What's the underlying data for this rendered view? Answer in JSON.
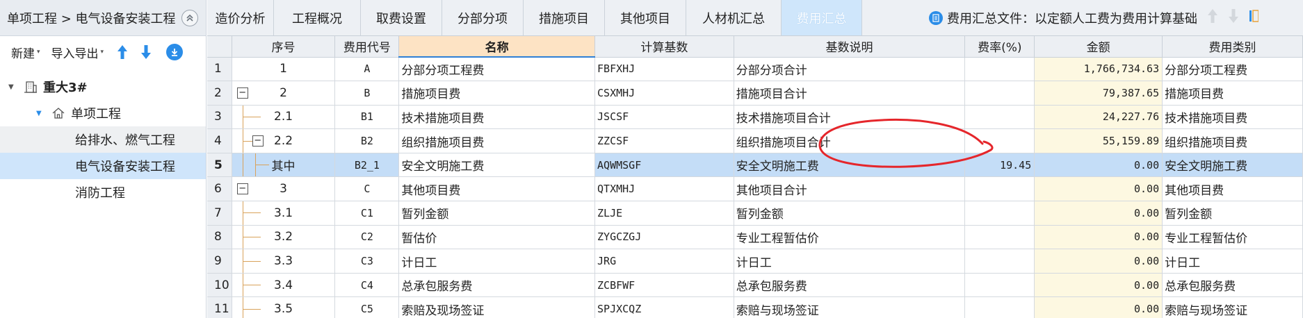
{
  "breadcrumb": {
    "text": "单项工程 > 电气设备安装工程"
  },
  "left_toolbar": {
    "new_label": "新建",
    "import_export_label": "导入导出"
  },
  "tree": [
    {
      "label": "重大3#",
      "level": 0
    },
    {
      "label": "单项工程",
      "level": 1
    },
    {
      "label": "给排水、燃气工程",
      "level": 2
    },
    {
      "label": "电气设备安装工程",
      "level": 2
    },
    {
      "label": "消防工程",
      "level": 2
    }
  ],
  "tabs": [
    "造价分析",
    "工程概况",
    "取费设置",
    "分部分项",
    "措施项目",
    "其他项目",
    "人材机汇总",
    "费用汇总"
  ],
  "active_tab": "费用汇总",
  "info": {
    "text": "费用汇总文件：以定额人工费为费用计算基础"
  },
  "columns": [
    "序号",
    "费用代号",
    "名称",
    "计算基数",
    "基数说明",
    "费率(%)",
    "金额",
    "费用类别"
  ],
  "rows": [
    {
      "rn": "1",
      "seq": "1",
      "code": "A",
      "name": "分部分项工程费",
      "base": "FBFXHJ",
      "desc": "分部分项合计",
      "rate": "",
      "amount": "1,766,734.63",
      "cat": "分部分项工程费"
    },
    {
      "rn": "2",
      "seq": "2",
      "code": "B",
      "name": "措施项目费",
      "base": "CSXMHJ",
      "desc": "措施项目合计",
      "rate": "",
      "amount": "79,387.65",
      "cat": "措施项目费"
    },
    {
      "rn": "3",
      "seq": "2.1",
      "code": "B1",
      "name": "技术措施项目费",
      "base": "JSCSF",
      "desc": "技术措施项目合计",
      "rate": "",
      "amount": "24,227.76",
      "cat": "技术措施项目费"
    },
    {
      "rn": "4",
      "seq": "2.2",
      "code": "B2",
      "name": "组织措施项目费",
      "base": "ZZCSF",
      "desc": "组织措施项目合计",
      "rate": "",
      "amount": "55,159.89",
      "cat": "组织措施项目费"
    },
    {
      "rn": "5",
      "seq": "其中",
      "code": "B2_1",
      "name": "安全文明施工费",
      "base": "AQWMSGF",
      "desc": "安全文明施工费",
      "rate": "19.45",
      "amount": "0.00",
      "cat": "安全文明施工费"
    },
    {
      "rn": "6",
      "seq": "3",
      "code": "C",
      "name": "其他项目费",
      "base": "QTXMHJ",
      "desc": "其他项目合计",
      "rate": "",
      "amount": "0.00",
      "cat": "其他项目费"
    },
    {
      "rn": "7",
      "seq": "3.1",
      "code": "C1",
      "name": "暂列金额",
      "base": "ZLJE",
      "desc": "暂列金额",
      "rate": "",
      "amount": "0.00",
      "cat": "暂列金额"
    },
    {
      "rn": "8",
      "seq": "3.2",
      "code": "C2",
      "name": "暂估价",
      "base": "ZYGCZGJ",
      "desc": "专业工程暂估价",
      "rate": "",
      "amount": "0.00",
      "cat": "专业工程暂估价"
    },
    {
      "rn": "9",
      "seq": "3.3",
      "code": "C3",
      "name": "计日工",
      "base": "JRG",
      "desc": "计日工",
      "rate": "",
      "amount": "0.00",
      "cat": "计日工"
    },
    {
      "rn": "10",
      "seq": "3.4",
      "code": "C4",
      "name": "总承包服务费",
      "base": "ZCBFWF",
      "desc": "总承包服务费",
      "rate": "",
      "amount": "0.00",
      "cat": "总承包服务费"
    },
    {
      "rn": "11",
      "seq": "3.5",
      "code": "C5",
      "name": "索赔及现场签证",
      "base": "SPJXCQZ",
      "desc": "索赔与现场签证",
      "rate": "",
      "amount": "0.00",
      "cat": "索赔与现场签证"
    }
  ],
  "selected_row": 4,
  "colors": {
    "accent": "#2b8de8",
    "selected_row": "#c4ddf7",
    "name_header": "#fde3c4",
    "amount_bg": "#fdf8e1",
    "annotation": "#e5262b"
  }
}
